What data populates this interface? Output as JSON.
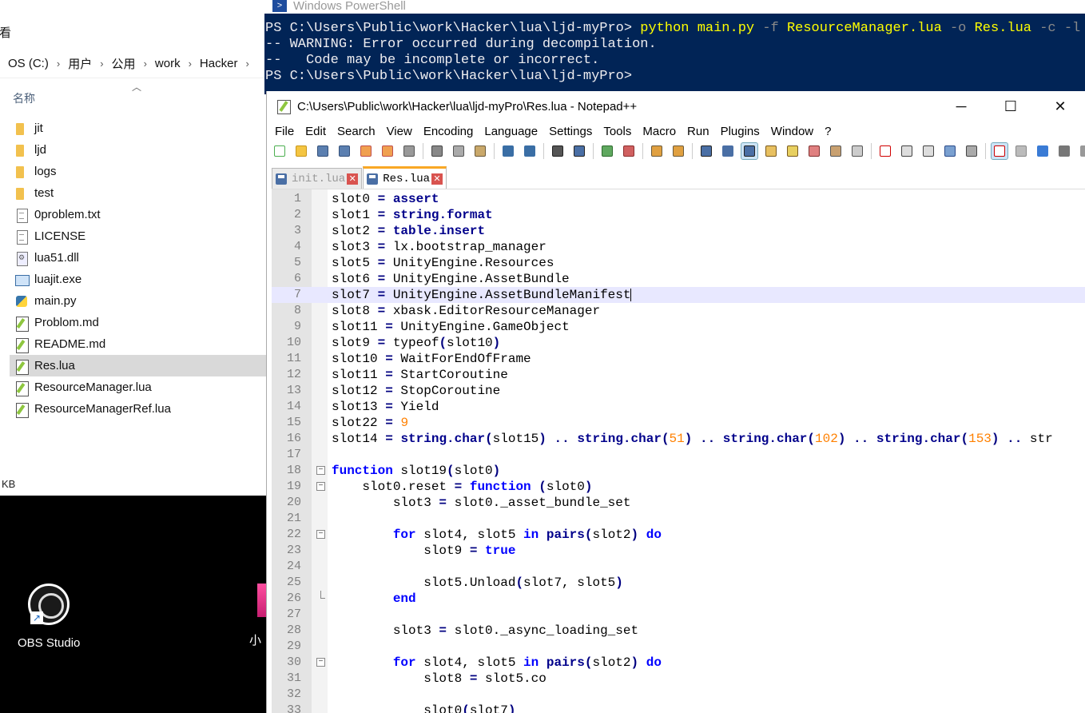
{
  "explorer": {
    "toolbar_fragment": "看",
    "breadcrumb": [
      "OS (C:)",
      "用户",
      "公用",
      "work",
      "Hacker"
    ],
    "column_name": "名称",
    "files": [
      {
        "name": "jit",
        "type": "folder"
      },
      {
        "name": "ljd",
        "type": "folder"
      },
      {
        "name": "logs",
        "type": "folder"
      },
      {
        "name": "test",
        "type": "folder"
      },
      {
        "name": "0problem.txt",
        "type": "doc"
      },
      {
        "name": "LICENSE",
        "type": "doc"
      },
      {
        "name": "lua51.dll",
        "type": "dll"
      },
      {
        "name": "luajit.exe",
        "type": "exe"
      },
      {
        "name": "main.py",
        "type": "py"
      },
      {
        "name": "Problom.md",
        "type": "npp"
      },
      {
        "name": "README.md",
        "type": "npp"
      },
      {
        "name": "Res.lua",
        "type": "npp",
        "selected": true
      },
      {
        "name": "ResourceManager.lua",
        "type": "npp"
      },
      {
        "name": "ResourceManagerRef.lua",
        "type": "npp"
      }
    ],
    "status_fragment": "KB"
  },
  "desktop": {
    "obs_label": "OBS Studio",
    "partial_label": "小"
  },
  "powershell": {
    "title": "Windows PowerShell",
    "prompt": "PS C:\\Users\\Public\\work\\Hacker\\lua\\ljd-myPro>",
    "cmd_python": "python",
    "cmd_main": "main.py",
    "flag_f": "-f",
    "file_in": "ResourceManager.lua",
    "flag_o": "-o",
    "file_out": "Res.lua",
    "flag_c": "-c",
    "flag_l": "-l",
    "warn1": "-- WARNING: Error occurred during decompilation.",
    "warn2": "--   Code may be incomplete or incorrect."
  },
  "notepad": {
    "title": "C:\\Users\\Public\\work\\Hacker\\lua\\ljd-myPro\\Res.lua - Notepad++",
    "menu": [
      "File",
      "Edit",
      "Search",
      "View",
      "Encoding",
      "Language",
      "Settings",
      "Tools",
      "Macro",
      "Run",
      "Plugins",
      "Window",
      "?"
    ],
    "tabs": [
      {
        "label": "init.lua",
        "active": false
      },
      {
        "label": "Res.lua",
        "active": true
      }
    ],
    "current_line": 7,
    "lines": [
      {
        "n": "1",
        "text": "slot0 = assert"
      },
      {
        "n": "2",
        "text": "slot1 = string.format"
      },
      {
        "n": "3",
        "text": "slot2 = table.insert"
      },
      {
        "n": "4",
        "text": "slot3 = lx.bootstrap_manager"
      },
      {
        "n": "5",
        "text": "slot5 = UnityEngine.Resources"
      },
      {
        "n": "6",
        "text": "slot6 = UnityEngine.AssetBundle"
      },
      {
        "n": "7",
        "text": "slot7 = UnityEngine.AssetBundleManifest"
      },
      {
        "n": "8",
        "text": "slot8 = xbask.EditorResourceManager"
      },
      {
        "n": "9",
        "text": "slot11 = UnityEngine.GameObject"
      },
      {
        "n": "10",
        "text": "slot9 = typeof(slot10)"
      },
      {
        "n": "11",
        "text": "slot10 = WaitForEndOfFrame"
      },
      {
        "n": "12",
        "text": "slot11 = StartCoroutine"
      },
      {
        "n": "13",
        "text": "slot12 = StopCoroutine"
      },
      {
        "n": "14",
        "text": "slot13 = Yield"
      },
      {
        "n": "15",
        "text": "slot22 = 9"
      },
      {
        "n": "16",
        "text": "slot14 = string.char(slot15) .. string.char(51) .. string.char(102) .. string.char(153) .. str"
      },
      {
        "n": "17",
        "text": ""
      },
      {
        "n": "18",
        "text": "function slot19(slot0)"
      },
      {
        "n": "19",
        "text": "    slot0.reset = function (slot0)"
      },
      {
        "n": "20",
        "text": "        slot3 = slot0._asset_bundle_set"
      },
      {
        "n": "21",
        "text": ""
      },
      {
        "n": "22",
        "text": "        for slot4, slot5 in pairs(slot2) do"
      },
      {
        "n": "23",
        "text": "            slot9 = true"
      },
      {
        "n": "24",
        "text": ""
      },
      {
        "n": "25",
        "text": "            slot5.Unload(slot7, slot5)"
      },
      {
        "n": "26",
        "text": "        end"
      },
      {
        "n": "27",
        "text": ""
      },
      {
        "n": "28",
        "text": "        slot3 = slot0._async_loading_set"
      },
      {
        "n": "29",
        "text": ""
      },
      {
        "n": "30",
        "text": "        for slot4, slot5 in pairs(slot2) do"
      },
      {
        "n": "31",
        "text": "            slot8 = slot5.co"
      },
      {
        "n": "32",
        "text": ""
      },
      {
        "n": "33",
        "text": "            slot0(slot7)"
      }
    ],
    "fold_lines": [
      "18",
      "19",
      "22",
      "30"
    ],
    "fold_end_lines": [
      "26"
    ]
  }
}
